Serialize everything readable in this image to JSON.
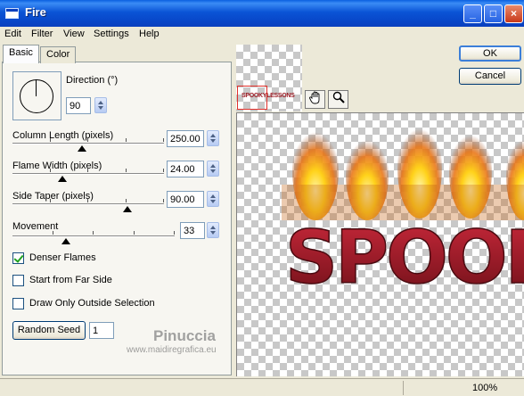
{
  "window": {
    "title": "Fire",
    "controls": [
      "_",
      "□",
      "×"
    ]
  },
  "menu": [
    "Edit",
    "Filter",
    "View",
    "Settings",
    "Help"
  ],
  "tabs": [
    {
      "label": "Basic",
      "active": true
    },
    {
      "label": "Color",
      "active": false
    }
  ],
  "direction": {
    "label": "Direction (°)",
    "value": "90"
  },
  "sliders": [
    {
      "label": "Column Length (pixels)",
      "value": "250.00",
      "fraction": 0.46
    },
    {
      "label": "Flame Width (pixels)",
      "value": "24.00",
      "fraction": 0.33
    },
    {
      "label": "Side Taper (pixels)",
      "value": "90.00",
      "fraction": 0.76
    },
    {
      "label": "Movement",
      "value": "33",
      "fraction": 0.33
    }
  ],
  "checkboxes": [
    {
      "label": "Denser Flames",
      "checked": true
    },
    {
      "label": "Start from Far Side",
      "checked": false
    },
    {
      "label": "Draw Only Outside Selection",
      "checked": false
    }
  ],
  "random_seed": {
    "label": "Random Seed",
    "value": "1"
  },
  "buttons": {
    "ok": "OK",
    "cancel": "Cancel"
  },
  "preview": {
    "text": "SPOOK",
    "thumb_text": "SPOOKYLESSONS"
  },
  "watermark": {
    "name": "Pinuccia",
    "url": "www.maidiregrafica.eu"
  },
  "status": {
    "zoom": "100%"
  },
  "colors": {
    "title_bar": "#0a54d6",
    "text_red": "#9c1b24",
    "flame": "#f7a21b"
  }
}
